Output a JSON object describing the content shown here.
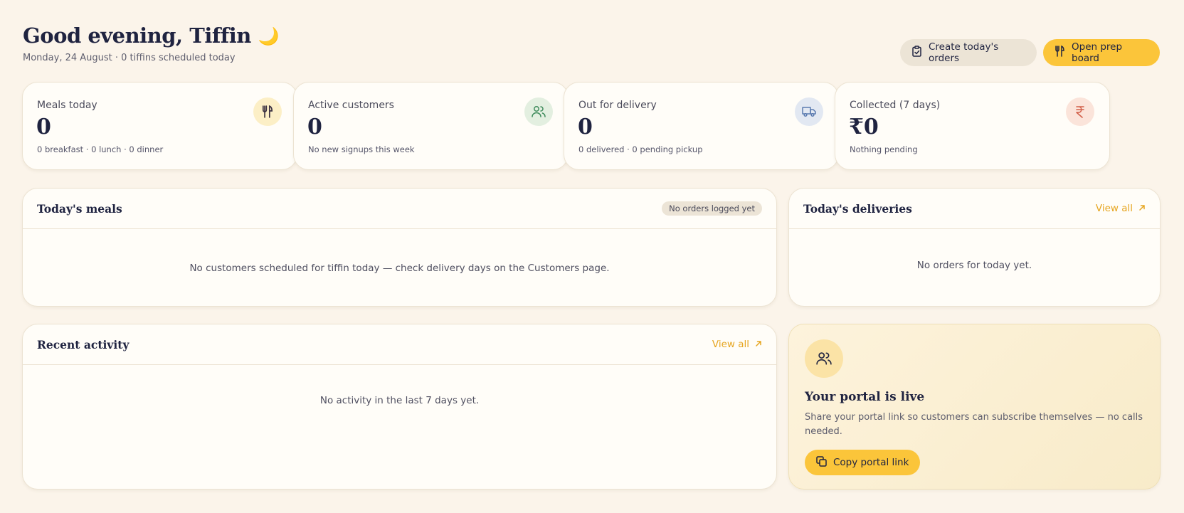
{
  "header": {
    "greeting": "Good evening, Tiffin",
    "greeting_emoji": "🌙",
    "subline": "Monday, 24 August · 0 tiffins scheduled today",
    "create_orders_label": "Create today's orders",
    "open_prep_label": "Open prep board"
  },
  "stats": [
    {
      "label": "Meals today",
      "value": "0",
      "sub": "0 breakfast · 0 lunch · 0 dinner",
      "icon": "fork-knife-icon",
      "icon_bg": "#fcefc6",
      "icon_color": "#3a3040"
    },
    {
      "label": "Active customers",
      "value": "0",
      "sub": "No new signups this week",
      "icon": "users-icon",
      "icon_bg": "#e3efe0",
      "icon_color": "#3d8a5a"
    },
    {
      "label": "Out for delivery",
      "value": "0",
      "sub": "0 delivered · 0 pending pickup",
      "icon": "truck-icon",
      "icon_bg": "#e2e8f2",
      "icon_color": "#5a7ab0"
    },
    {
      "label": "Collected (7 days)",
      "value": "₹0",
      "sub": "Nothing pending",
      "icon": "rupee-icon",
      "icon_bg": "#fbe4da",
      "icon_color": "#d2604a"
    }
  ],
  "meals_panel": {
    "title": "Today's meals",
    "badge": "No orders logged yet",
    "empty_message": "No customers scheduled for tiffin today — check delivery days on the Customers page."
  },
  "deliveries_panel": {
    "title": "Today's deliveries",
    "view_all": "View all",
    "empty_message": "No orders for today yet."
  },
  "activity_panel": {
    "title": "Recent activity",
    "view_all": "View all",
    "empty_message": "No activity in the last 7 days yet."
  },
  "portal_card": {
    "title": "Your portal is live",
    "description": "Share your portal link so customers can subscribe themselves — no calls needed.",
    "button_label": "Copy portal link"
  },
  "colors": {
    "background": "#fbf4ea",
    "accent": "#fbc53a",
    "link": "#e6a520",
    "heading": "#1f2340"
  }
}
